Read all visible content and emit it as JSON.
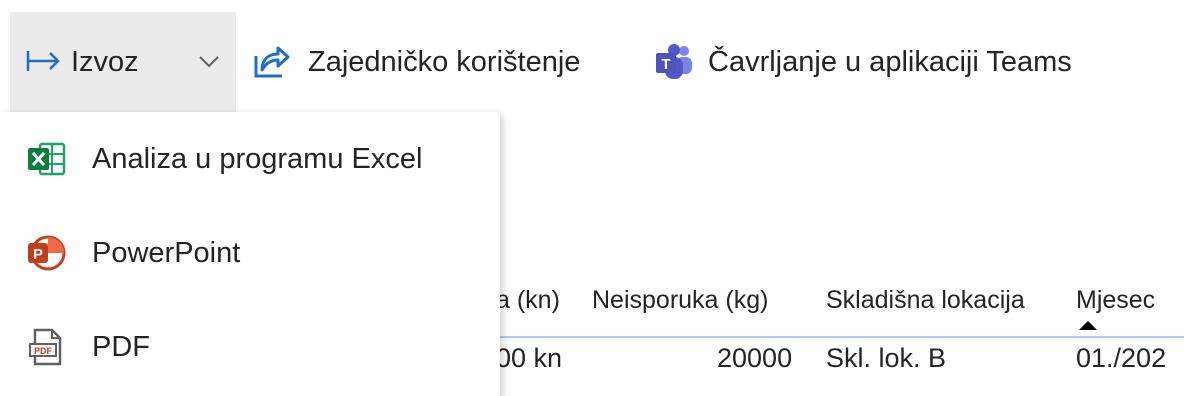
{
  "toolbar": {
    "export_label": "Izvoz",
    "share_label": "Zajedničko korištenje",
    "teams_label": "Čavrljanje u aplikaciji Teams"
  },
  "dropdown": {
    "items": [
      {
        "label": "Analiza u programu Excel",
        "icon": "excel-icon"
      },
      {
        "label": "PowerPoint",
        "icon": "powerpoint-icon"
      },
      {
        "label": "PDF",
        "icon": "pdf-icon"
      }
    ]
  },
  "table": {
    "headers": [
      "a (kn)",
      "Neisporuka (kg)",
      "Skladišna lokacija",
      "Mjesec"
    ],
    "row": [
      "00 kn",
      "20000",
      "Skl. lok. B",
      "01./202"
    ]
  },
  "colors": {
    "accent_blue": "#1f6fc9",
    "excel_green": "#21a366",
    "powerpoint_orange": "#c43e1c",
    "teams_purple": "#5059c9",
    "hover_gray": "#ebebeb"
  }
}
